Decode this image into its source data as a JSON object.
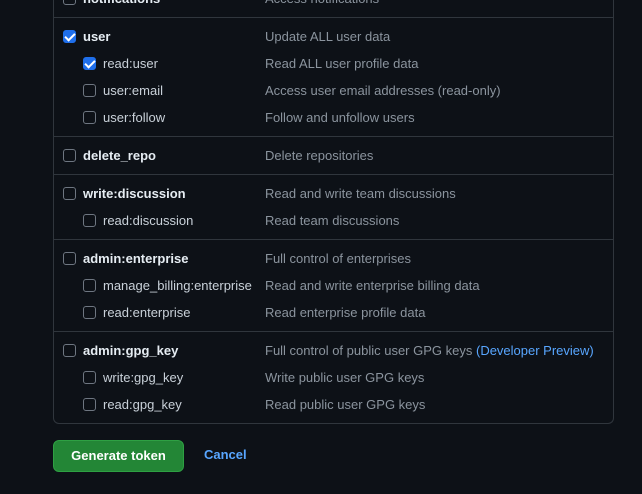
{
  "scopes": [
    {
      "items": [
        {
          "name": "notifications",
          "desc": "Access notifications",
          "checked": false,
          "level": "top"
        }
      ]
    },
    {
      "items": [
        {
          "name": "user",
          "desc": "Update ALL user data",
          "checked": true,
          "level": "top"
        },
        {
          "name": "read:user",
          "desc": "Read ALL user profile data",
          "checked": true,
          "level": "sub"
        },
        {
          "name": "user:email",
          "desc": "Access user email addresses (read-only)",
          "checked": false,
          "level": "sub"
        },
        {
          "name": "user:follow",
          "desc": "Follow and unfollow users",
          "checked": false,
          "level": "sub"
        }
      ]
    },
    {
      "items": [
        {
          "name": "delete_repo",
          "desc": "Delete repositories",
          "checked": false,
          "level": "top"
        }
      ]
    },
    {
      "items": [
        {
          "name": "write:discussion",
          "desc": "Read and write team discussions",
          "checked": false,
          "level": "top"
        },
        {
          "name": "read:discussion",
          "desc": "Read team discussions",
          "checked": false,
          "level": "sub"
        }
      ]
    },
    {
      "items": [
        {
          "name": "admin:enterprise",
          "desc": "Full control of enterprises",
          "checked": false,
          "level": "top"
        },
        {
          "name": "manage_billing:enterprise",
          "desc": "Read and write enterprise billing data",
          "checked": false,
          "level": "sub"
        },
        {
          "name": "read:enterprise",
          "desc": "Read enterprise profile data",
          "checked": false,
          "level": "sub"
        }
      ]
    },
    {
      "items": [
        {
          "name": "admin:gpg_key",
          "desc": "Full control of public user GPG keys",
          "desc_extra": "(Developer Preview)",
          "checked": false,
          "level": "top"
        },
        {
          "name": "write:gpg_key",
          "desc": "Write public user GPG keys",
          "checked": false,
          "level": "sub"
        },
        {
          "name": "read:gpg_key",
          "desc": "Read public user GPG keys",
          "checked": false,
          "level": "sub"
        }
      ]
    }
  ],
  "actions": {
    "generate_label": "Generate token",
    "cancel_label": "Cancel"
  },
  "colors": {
    "background": "#0d1117",
    "border": "#30363d",
    "checkbox_checked": "#1f6feb",
    "primary_button": "#238636",
    "link": "#58a6ff",
    "muted_text": "#8b949e"
  }
}
